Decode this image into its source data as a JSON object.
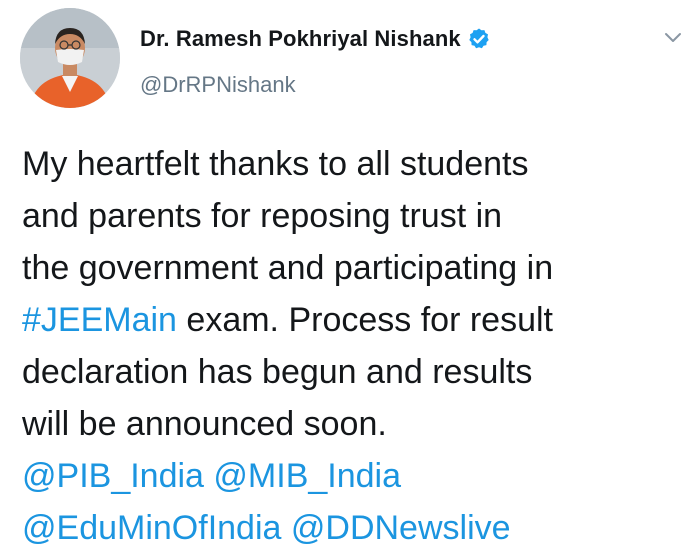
{
  "author": {
    "display_name": "Dr. Ramesh Pokhriyal Nishank",
    "handle": "@DrRPNishank",
    "verified": true,
    "avatar_icon": "profile-photo"
  },
  "menu_icon": "chevron-down-icon",
  "tweet": {
    "line1": "My heartfelt thanks to all students",
    "line2": "and parents for reposing trust in",
    "line3": "the government and participating in",
    "hashtag": "#JEEMain",
    "line4_rest": " exam. Process for result",
    "line5": "declaration has begun and results",
    "line6": "will be announced soon.",
    "mentions": [
      "@PIB_India",
      "@MIB_India",
      "@EduMinOfIndia",
      "@DDNewslive"
    ]
  },
  "colors": {
    "link": "#1b95e0",
    "verified_badge": "#1da1f2",
    "handle": "#657786",
    "text": "#14171a"
  }
}
